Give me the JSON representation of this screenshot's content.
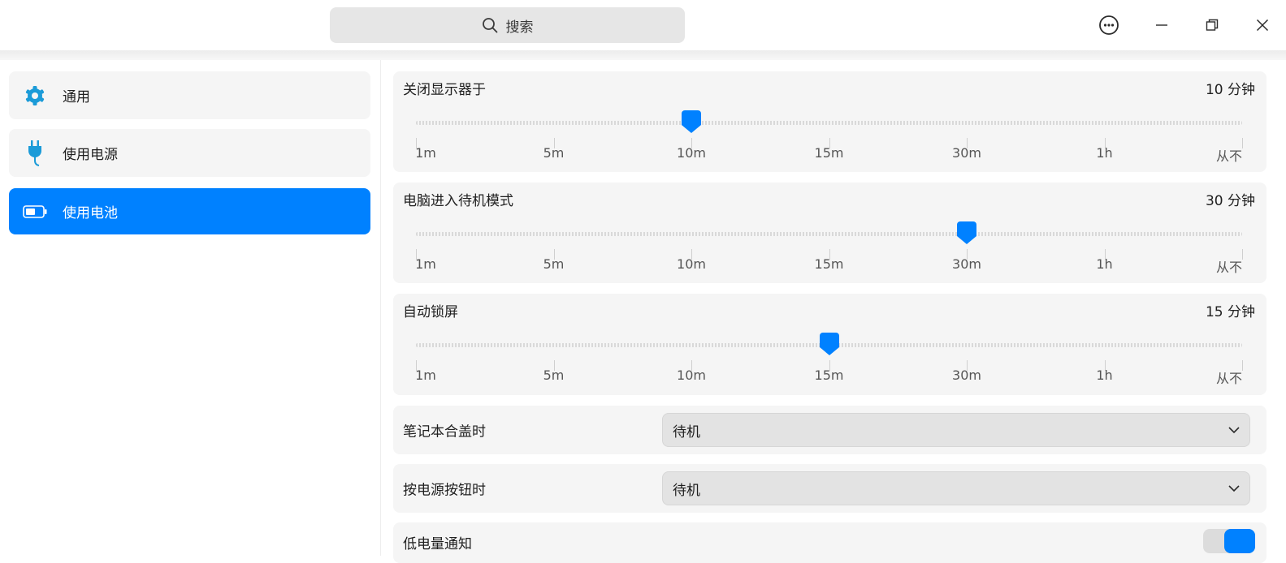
{
  "search": {
    "label": "搜索",
    "icon": "search-icon"
  },
  "window_controls": {
    "menu_icon": "more-icon",
    "minimize_icon": "minimize-icon",
    "restore_icon": "restore-icon",
    "close_icon": "close-icon"
  },
  "sidebar": {
    "items": [
      {
        "label": "通用",
        "icon": "gear-icon",
        "active": false
      },
      {
        "label": "使用电源",
        "icon": "plug-icon",
        "active": false
      },
      {
        "label": "使用电池",
        "icon": "battery-icon",
        "active": true
      }
    ]
  },
  "colors": {
    "accent": "#0081ff",
    "card_bg": "#f5f5f5"
  },
  "sliders": [
    {
      "label": "关闭显示器于",
      "value_text": "10 分钟",
      "selected_index": 2,
      "ticks": [
        "1m",
        "5m",
        "10m",
        "15m",
        "30m",
        "1h",
        "从不"
      ]
    },
    {
      "label": "电脑进入待机模式",
      "value_text": "30 分钟",
      "selected_index": 4,
      "ticks": [
        "1m",
        "5m",
        "10m",
        "15m",
        "30m",
        "1h",
        "从不"
      ]
    },
    {
      "label": "自动锁屏",
      "value_text": "15 分钟",
      "selected_index": 3,
      "ticks": [
        "1m",
        "5m",
        "10m",
        "15m",
        "30m",
        "1h",
        "从不"
      ]
    }
  ],
  "lid_close": {
    "label": "笔记本合盖时",
    "value": "待机"
  },
  "power_button": {
    "label": "按电源按钮时",
    "value": "待机"
  },
  "low_battery": {
    "label": "低电量通知",
    "enabled": true
  }
}
